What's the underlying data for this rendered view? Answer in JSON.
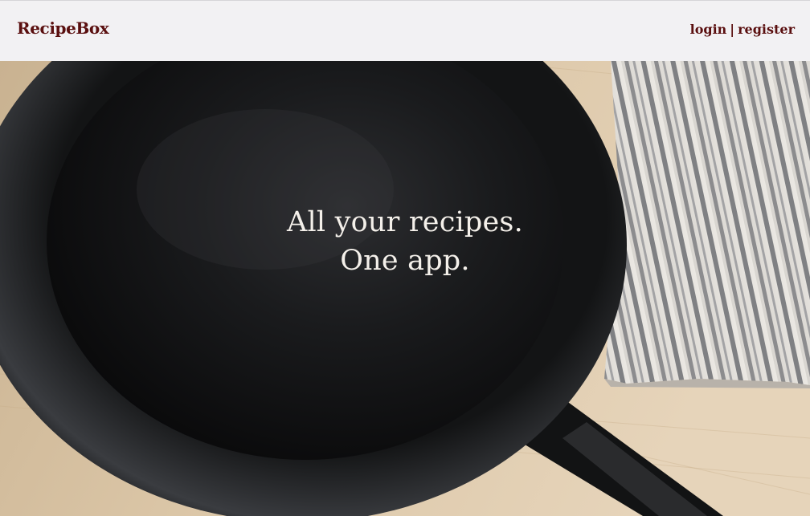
{
  "navbar": {
    "brand": "RecipeBox",
    "login_label": "login",
    "separator": "|",
    "register_label": "register"
  },
  "hero": {
    "line1": "All your recipes.",
    "line2": "One app.",
    "image_description_icon": "cast-iron-skillet-image"
  },
  "colors": {
    "brand": "#5a0f0f",
    "navbar_bg": "#f2f1f3",
    "hero_text": "#f4f0ea"
  }
}
